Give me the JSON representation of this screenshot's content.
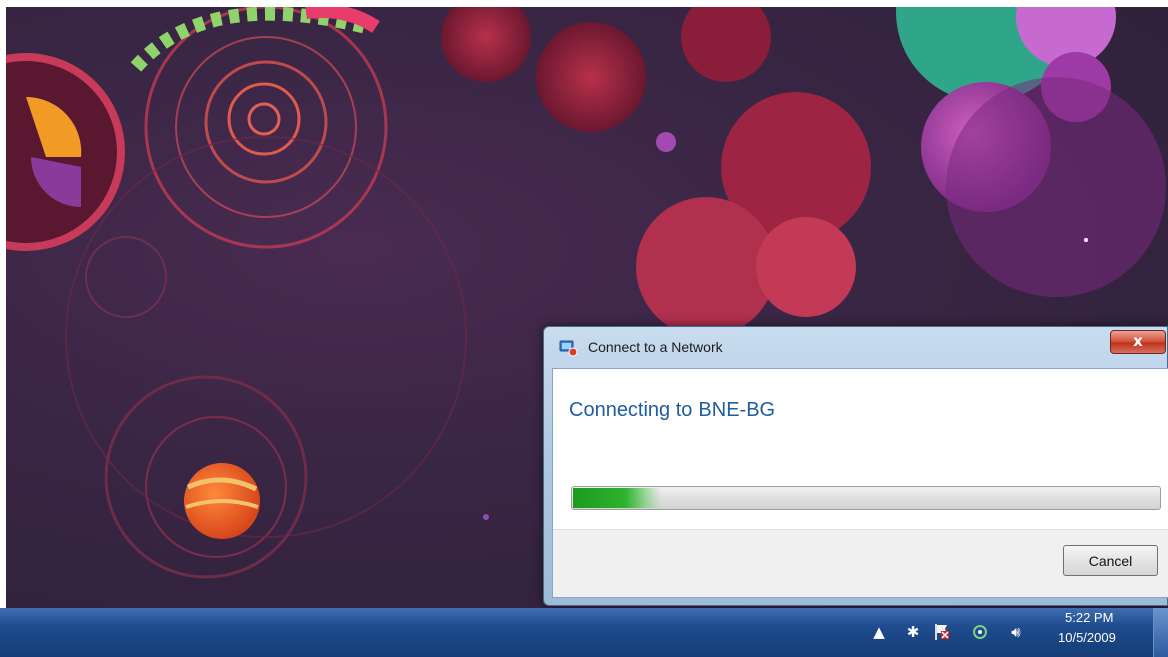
{
  "dialog": {
    "title": "Connect to a Network",
    "close_label": "x",
    "message_prefix": "Connecting to",
    "network_name": "BNE-BG",
    "progress": 0.15,
    "cancel_label": "Cancel"
  },
  "taskbar": {
    "time": "5:22 PM",
    "date": "10/5/2009",
    "tray_icons": [
      "show-hidden-icons",
      "bluetooth-icon",
      "action-center-flag-icon",
      "network-icon",
      "volume-icon"
    ]
  }
}
